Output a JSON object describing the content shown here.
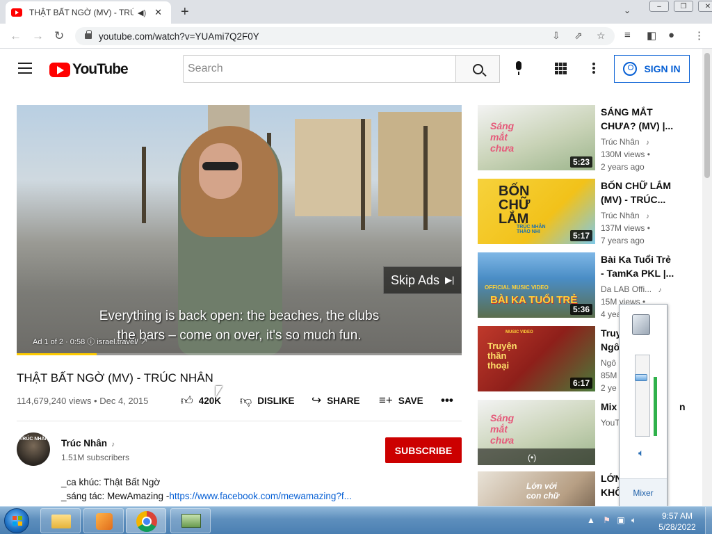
{
  "browser": {
    "tab_title": "THẬT BẤT NGỜ (MV) - TRÚC",
    "url": "youtube.com/watch?v=YUAmi7Q2F0Y"
  },
  "header": {
    "logo_text": "YouTube",
    "search_placeholder": "Search",
    "sign_in": "SIGN IN"
  },
  "player": {
    "skip_label": "Skip Ads",
    "caption_line1": "Everything is back open: the beaches, the clubs",
    "caption_line2": "the bars – come on over, it's so much fun.",
    "ad_info": "Ad 1 of 2 · 0:58",
    "ad_source": "israel.travel/",
    "ad_progress": 0.18
  },
  "video": {
    "title": "THẬT BẤT NGỜ (MV) - TRÚC NHÂN",
    "views_date": "114,679,240 views • Dec 4, 2015",
    "like_count": "420K",
    "dislike_label": "DISLIKE",
    "share_label": "SHARE",
    "save_label": "SAVE"
  },
  "channel": {
    "avatar_text": "TRÚC NHÂN",
    "name": "Trúc Nhân",
    "subscribers": "1.51M subscribers",
    "subscribe_label": "SUBSCRIBE"
  },
  "description": {
    "line1": "_ca khúc: Thật Bất Ngờ",
    "line2_prefix": "_sáng tác: MewAmazing -",
    "line2_link": "https://www.facebook.com/mewamazing?f..."
  },
  "recommendations": [
    {
      "title_l1": "SÁNG MẮT",
      "title_l2": "CHƯA? (MV) |...",
      "channel": "Trúc Nhân",
      "views": "130M views •",
      "age": "2 years ago",
      "duration": "5:23",
      "thumb_text": "Sáng mắt chưa"
    },
    {
      "title_l1": "BỐN CHỮ LẮM",
      "title_l2": "(MV) - TRÚC...",
      "channel": "Trúc Nhân",
      "views": "137M views •",
      "age": "7 years ago",
      "duration": "5:17",
      "thumb_text": "BỐN CHỮ LẮM",
      "thumb_sub": "TRÚC NHÂN THẢO NHI"
    },
    {
      "title_l1": "Bài Ka Tuổi Trẻ",
      "title_l2": "- TamKa PKL |...",
      "channel": "Da LAB Offi...",
      "views": "15M views •",
      "age": "4 yea",
      "duration": "5:36",
      "thumb_text": "BÀI KA TUỔI TRẺ",
      "thumb_sub": "OFFICIAL MUSIC VIDEO"
    },
    {
      "title_l1": "Truy",
      "title_l2": "Ngô",
      "channel": "Ngô",
      "views": "85M",
      "age": "2 ye",
      "duration": "6:17",
      "thumb_text": "Truyện thần thoại",
      "thumb_sub": "MUSIC VIDEO"
    },
    {
      "title_l1": "Mix",
      "title_l2": "",
      "channel": "YouT",
      "views": "",
      "age": "",
      "duration": "(•)",
      "thumb_text": "Sáng mắt chưa",
      "extra": "n"
    },
    {
      "title_l1": "LỚN",
      "title_l2": "KHÔ",
      "channel": "",
      "views": "",
      "age": "",
      "duration": "",
      "thumb_text": "Lớn với con chữ"
    }
  ],
  "volume": {
    "level": 0.72,
    "mixer_label": "Mixer"
  },
  "taskbar": {
    "time": "9:57 AM",
    "date": "5/28/2022"
  }
}
